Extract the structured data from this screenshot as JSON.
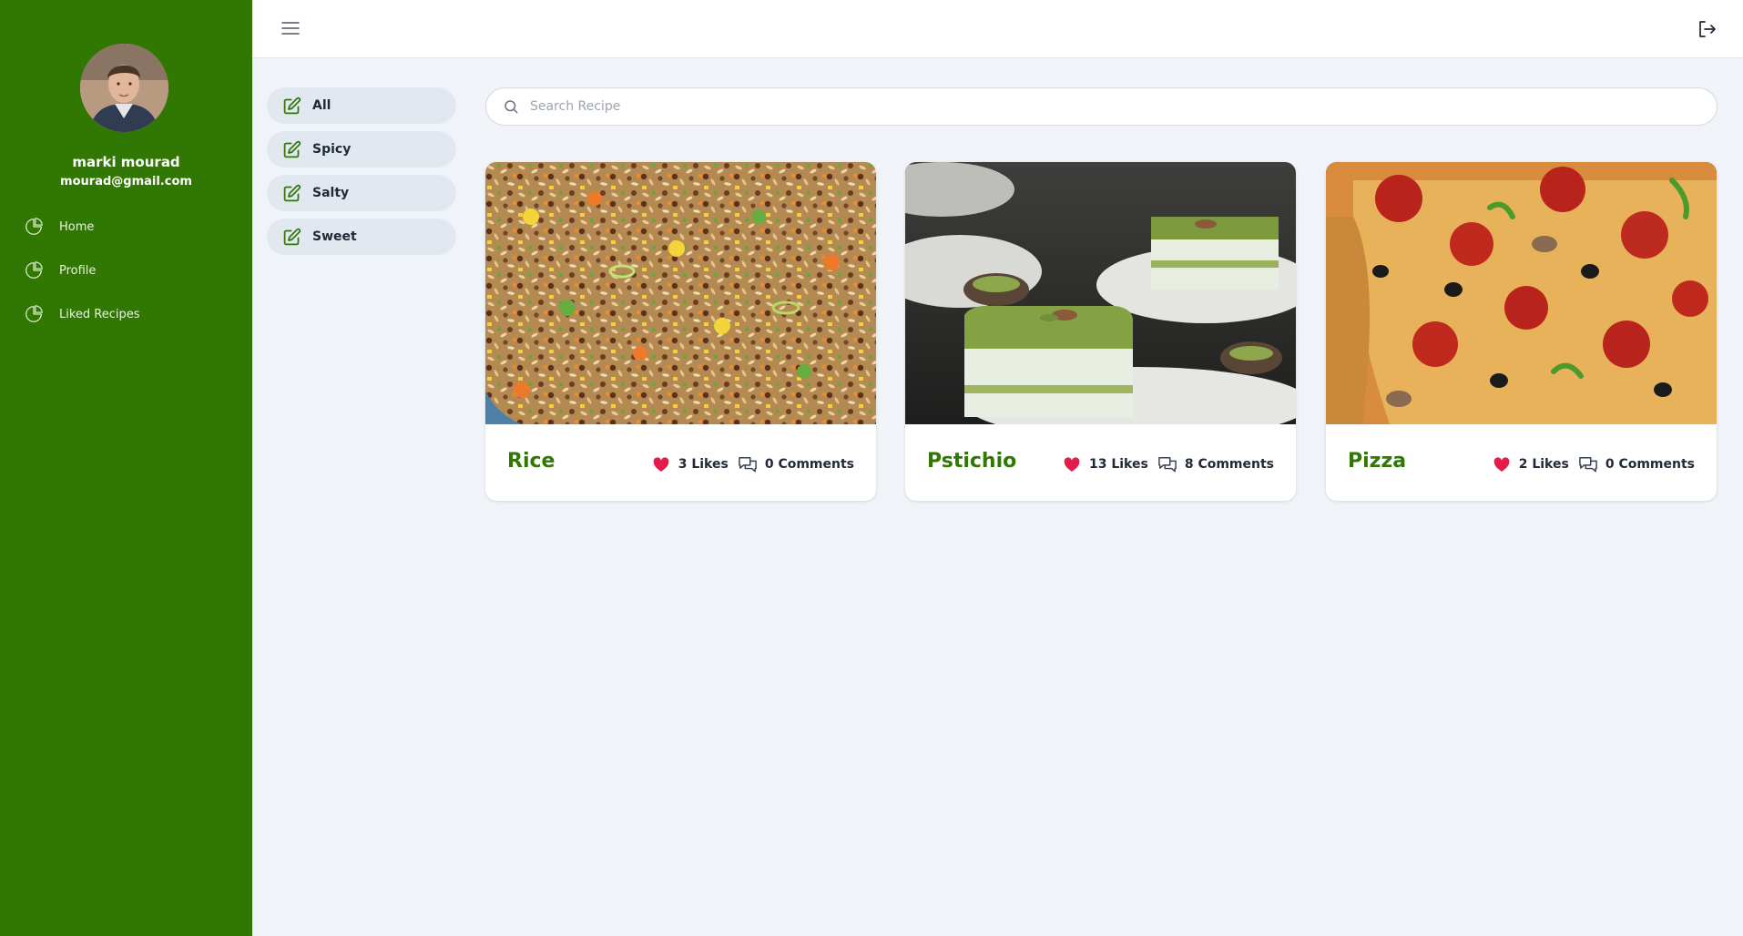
{
  "user": {
    "name": "marki mourad",
    "email": "mourad@gmail.com"
  },
  "sidebar": {
    "items": [
      {
        "label": "Home",
        "icon": "pie-chart-icon"
      },
      {
        "label": "Profile",
        "icon": "pie-chart-icon"
      },
      {
        "label": "Liked Recipes",
        "icon": "pie-chart-icon"
      }
    ]
  },
  "topbar": {
    "menu_icon": "hamburger-menu-icon",
    "logout_icon": "logout-icon"
  },
  "categories": [
    {
      "label": "All",
      "icon": "edit-icon"
    },
    {
      "label": "Spicy",
      "icon": "edit-icon"
    },
    {
      "label": "Salty",
      "icon": "edit-icon"
    },
    {
      "label": "Sweet",
      "icon": "edit-icon"
    }
  ],
  "search": {
    "placeholder": "Search Recipe",
    "value": ""
  },
  "recipes": [
    {
      "title": "Rice",
      "likes": "3 Likes",
      "comments": "0 Comments",
      "image": "fried-rice-photo"
    },
    {
      "title": "Pstichio",
      "likes": "13 Likes",
      "comments": "8 Comments",
      "image": "pistachio-cake-photo"
    },
    {
      "title": "Pizza",
      "likes": "2 Likes",
      "comments": "0 Comments",
      "image": "pepperoni-pizza-photo"
    }
  ],
  "colors": {
    "sidebar": "#317703",
    "accent": "#317703",
    "background": "#f0f3f8",
    "heart": "#e11d48",
    "category_bg": "#e2e8f0"
  }
}
